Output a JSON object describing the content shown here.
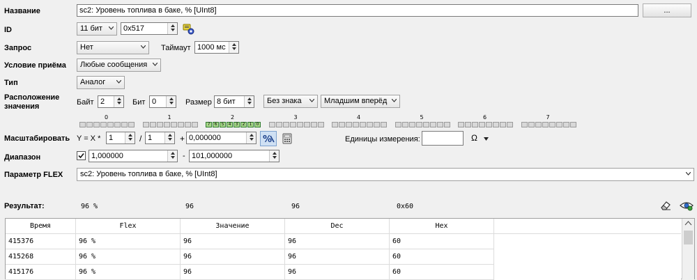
{
  "form": {
    "name_label": "Название",
    "name_value": "sc2: Уровень топлива в баке, % [UInt8]",
    "browse_button": "...",
    "id_label": "ID",
    "id_bits": "11 бит",
    "id_value": "0x517",
    "request_label": "Запрос",
    "request_value": "Нет",
    "timeout_label": "Таймаут",
    "timeout_value": "1000 мс",
    "condition_label": "Условие приёма",
    "condition_value": "Любые сообщения",
    "type_label": "Тип",
    "type_value": "Аналог",
    "location_label_1": "Расположение",
    "location_label_2": "значения",
    "byte_label": "Байт",
    "byte_value": "2",
    "bit_label": "Бит",
    "bit_value": "0",
    "size_label": "Размер",
    "size_value": "8 бит",
    "sign_value": "Без знака",
    "order_value": "Младшим вперёд",
    "scale_label": "Масштабировать",
    "scale_formula": "Y = X *",
    "scale_num": "1",
    "scale_slash": "/",
    "scale_den": "1",
    "scale_plus": "+",
    "scale_offset": "0,000000",
    "units_label": "Единицы измерения:",
    "units_value": "",
    "ohm_symbol": "Ω",
    "range_label": "Диапазон",
    "range_min": "1,000000",
    "range_dash": "-",
    "range_max": "101,000000",
    "flex_label": "Параметр FLEX",
    "flex_value": "sc2: Уровень топлива в баке, % [UInt8]"
  },
  "bytes": [
    "0",
    "1",
    "2",
    "3",
    "4",
    "5",
    "6",
    "7"
  ],
  "active_bits": [
    "7",
    "6",
    "5",
    "4",
    "3",
    "2",
    "1",
    "0"
  ],
  "result": {
    "label": "Результат:",
    "flex": "96 %",
    "value": "96",
    "dec": "96",
    "hex": "0x60"
  },
  "table": {
    "headers": [
      "Время",
      "Flex",
      "Значение",
      "Dec",
      "Hex"
    ],
    "rows": [
      [
        "415376",
        "96 %",
        "96",
        "96",
        "60"
      ],
      [
        "415268",
        "96 %",
        "96",
        "96",
        "60"
      ],
      [
        "415176",
        "96 %",
        "96",
        "96",
        "60"
      ]
    ]
  }
}
